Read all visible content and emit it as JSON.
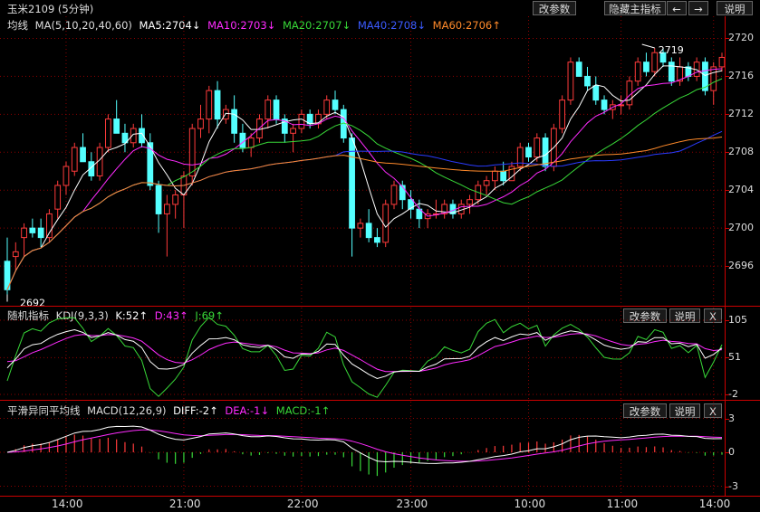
{
  "title": "玉米2109 (5分钟)",
  "toolbar": {
    "params": "改参数",
    "hide_indicator": "隐藏主指标",
    "left_arrow": "←",
    "right_arrow": "→",
    "help": "说明"
  },
  "main": {
    "legend": {
      "label": "均线",
      "params": "MA(5,10,20,40,60)",
      "ma5": "MA5:2704↓",
      "ma10": "MA10:2703↓",
      "ma20": "MA20:2707↓",
      "ma40": "MA40:2708↓",
      "ma60": "MA60:2706↑"
    },
    "y_ticks": [
      "2720",
      "2716",
      "2712",
      "2708",
      "2704",
      "2700",
      "2696"
    ],
    "high_label": "2719",
    "low_label": "2692"
  },
  "kdj": {
    "label": "随机指标",
    "params": "KDJ(9,3,3)",
    "k": "K:52↑",
    "d": "D:43↑",
    "j": "J:69↑",
    "params_btn": "改参数",
    "help_btn": "说明",
    "close_btn": "X",
    "y_ticks": [
      "105",
      "51",
      "-2"
    ]
  },
  "macd": {
    "label": "平滑异同平均线",
    "params": "MACD(12,26,9)",
    "diff": "DIFF:-2↑",
    "dea": "DEA:-1↓",
    "macd": "MACD:-1↑",
    "params_btn": "改参数",
    "help_btn": "说明",
    "close_btn": "X",
    "y_ticks": [
      "3",
      "0",
      "-3"
    ]
  },
  "x_labels": [
    "14:00",
    "21:00",
    "22:00",
    "23:00",
    "10:00",
    "11:00",
    "14:00"
  ],
  "colors": {
    "up": "#ff3b3b",
    "down": "#54ffff",
    "ma5": "#ffffff",
    "ma10": "#ff2bff",
    "ma20": "#38d838",
    "ma40": "#2a3bff",
    "ma60": "#ff8a2a",
    "grid": "#8b0000"
  },
  "chart_data": {
    "type": "candlestick",
    "ylim": [
      2692,
      2721
    ],
    "candles_ohlc": [
      [
        2696.5,
        2699,
        2693,
        2693.5
      ],
      [
        2697,
        2698.5,
        2695.5,
        2697.5
      ],
      [
        2699,
        2700.5,
        2697,
        2700
      ],
      [
        2700,
        2701,
        2699,
        2699.5
      ],
      [
        2700,
        2701,
        2698,
        2699
      ],
      [
        2699,
        2702,
        2698.5,
        2701.5
      ],
      [
        2702,
        2705,
        2701,
        2704.5
      ],
      [
        2704.5,
        2707,
        2703.5,
        2706.5
      ],
      [
        2706,
        2709,
        2705.5,
        2708.5
      ],
      [
        2708.5,
        2710,
        2707,
        2707
      ],
      [
        2707,
        2708,
        2705,
        2705.5
      ],
      [
        2705.5,
        2709,
        2705,
        2708.5
      ],
      [
        2708.5,
        2712,
        2708,
        2711.5
      ],
      [
        2711.5,
        2713.5,
        2710.5,
        2710
      ],
      [
        2710,
        2711,
        2708,
        2709
      ],
      [
        2709,
        2711,
        2708.5,
        2710.5
      ],
      [
        2710.5,
        2712,
        2708.5,
        2709
      ],
      [
        2709,
        2710,
        2704,
        2704.5
      ],
      [
        2704.5,
        2705,
        2699.5,
        2701.5
      ],
      [
        2701.5,
        2703.5,
        2697,
        2702.5
      ],
      [
        2702.5,
        2704,
        2701,
        2703.5
      ],
      [
        2703.5,
        2706,
        2700,
        2705.5
      ],
      [
        2705.5,
        2711,
        2704.5,
        2710.5
      ],
      [
        2710.5,
        2713,
        2709.5,
        2711.5
      ],
      [
        2711.5,
        2715,
        2710,
        2714.5
      ],
      [
        2714.5,
        2715.5,
        2710.5,
        2711.5
      ],
      [
        2711.5,
        2713,
        2711,
        2712.5
      ],
      [
        2712.5,
        2714,
        2709,
        2710
      ],
      [
        2710,
        2711,
        2708,
        2708.5
      ],
      [
        2708.5,
        2710,
        2707.5,
        2709.5
      ],
      [
        2709.5,
        2712,
        2709,
        2711.5
      ],
      [
        2711.5,
        2714,
        2710.5,
        2713.5
      ],
      [
        2713.5,
        2714,
        2711,
        2711.5
      ],
      [
        2711.5,
        2712,
        2709,
        2710
      ],
      [
        2710,
        2711,
        2708,
        2710.5
      ],
      [
        2710.5,
        2712.5,
        2710,
        2712
      ],
      [
        2712,
        2712.5,
        2710.5,
        2711
      ],
      [
        2711,
        2712.5,
        2710.5,
        2712
      ],
      [
        2712,
        2714,
        2711.5,
        2713.5
      ],
      [
        2713.5,
        2714.5,
        2712,
        2712.5
      ],
      [
        2712.5,
        2713,
        2709,
        2709.5
      ],
      [
        2709.5,
        2710,
        2697,
        2700
      ],
      [
        2700,
        2701,
        2699,
        2700.5
      ],
      [
        2700.5,
        2702,
        2698.5,
        2699
      ],
      [
        2699,
        2700,
        2698,
        2698.5
      ],
      [
        2698.5,
        2703,
        2698,
        2702.5
      ],
      [
        2702.5,
        2705,
        2702,
        2704.5
      ],
      [
        2704.5,
        2705,
        2702,
        2703
      ],
      [
        2703,
        2704,
        2701,
        2702
      ],
      [
        2702,
        2703,
        2700,
        2701
      ],
      [
        2701,
        2702,
        2700,
        2701.5
      ],
      [
        2701.5,
        2703,
        2701,
        2701.5
      ],
      [
        2701.5,
        2703,
        2701,
        2702.5
      ],
      [
        2702.5,
        2703,
        2701,
        2701.5
      ],
      [
        2701.5,
        2703,
        2701,
        2702.5
      ],
      [
        2702.5,
        2703.5,
        2701.5,
        2703
      ],
      [
        2703,
        2705,
        2702.5,
        2704.5
      ],
      [
        2704.5,
        2705.5,
        2703.5,
        2705
      ],
      [
        2705,
        2706.5,
        2704,
        2706
      ],
      [
        2706,
        2707,
        2704.5,
        2705
      ],
      [
        2705,
        2707,
        2705,
        2706.5
      ],
      [
        2706.5,
        2709,
        2706,
        2708.5
      ],
      [
        2708.5,
        2709,
        2707,
        2707.5
      ],
      [
        2707.5,
        2710,
        2707,
        2709.5
      ],
      [
        2709.5,
        2710,
        2706,
        2706.5
      ],
      [
        2706.5,
        2711,
        2706,
        2710.5
      ],
      [
        2710.5,
        2714,
        2710,
        2713.5
      ],
      [
        2713.5,
        2718,
        2713,
        2717.5
      ],
      [
        2717.5,
        2718,
        2716,
        2716
      ],
      [
        2716,
        2717,
        2714.5,
        2715
      ],
      [
        2715,
        2716,
        2713,
        2713.5
      ],
      [
        2713.5,
        2714,
        2712,
        2712.5
      ],
      [
        2712.5,
        2713.5,
        2711.5,
        2713
      ],
      [
        2713,
        2714,
        2712,
        2713
      ],
      [
        2713,
        2716,
        2712.5,
        2715.5
      ],
      [
        2715.5,
        2718,
        2715,
        2717.5
      ],
      [
        2717.5,
        2718.5,
        2716,
        2716.5
      ],
      [
        2716.5,
        2719,
        2716,
        2718.5
      ],
      [
        2718.5,
        2719,
        2717,
        2717.5
      ],
      [
        2717.5,
        2718,
        2715,
        2715.5
      ],
      [
        2715.5,
        2718,
        2715,
        2717
      ],
      [
        2717,
        2717.5,
        2715.5,
        2716
      ],
      [
        2716,
        2718,
        2715.5,
        2717.5
      ],
      [
        2717.5,
        2718,
        2714,
        2714.5
      ],
      [
        2714.5,
        2717.5,
        2713,
        2717
      ],
      [
        2717,
        2718.5,
        2716.5,
        2718
      ]
    ]
  }
}
